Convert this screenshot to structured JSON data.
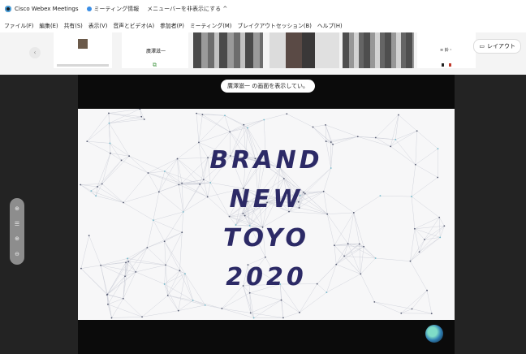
{
  "window": {
    "app_title": "Cisco Webex Meetings",
    "meeting_info": "ミーティング情報",
    "hide_menu": "メニューバーを非表示にする ^"
  },
  "menu": [
    "ファイル(F)",
    "編集(E)",
    "共有(S)",
    "表示(V)",
    "音声とビデオ(A)",
    "参加者(P)",
    "ミーティング(M)",
    "ブレイクアウトセッション(B)",
    "ヘルプ(H)"
  ],
  "participants": {
    "presenter_name": "廣澤滋一",
    "share_icon": "share-screen-icon",
    "tile6_text": "≡ 鈴・",
    "layout_label": "レイアウト",
    "layout_icon": "layout-icon"
  },
  "stage": {
    "sharing_notice": "廣澤滋一 の画面を表示してい。"
  },
  "slide": {
    "lines": [
      "BRAND",
      "NEW",
      "TOYO",
      "2020"
    ]
  },
  "zoom": {
    "icons": [
      "pan-icon",
      "hand-icon",
      "zoom-in-icon",
      "zoom-out-icon"
    ],
    "glyphs": [
      "⊕",
      "☰",
      "⊕",
      "⊖"
    ]
  },
  "colors": {
    "slide_text": "#2c2a66",
    "stage_bg": "#232323"
  }
}
